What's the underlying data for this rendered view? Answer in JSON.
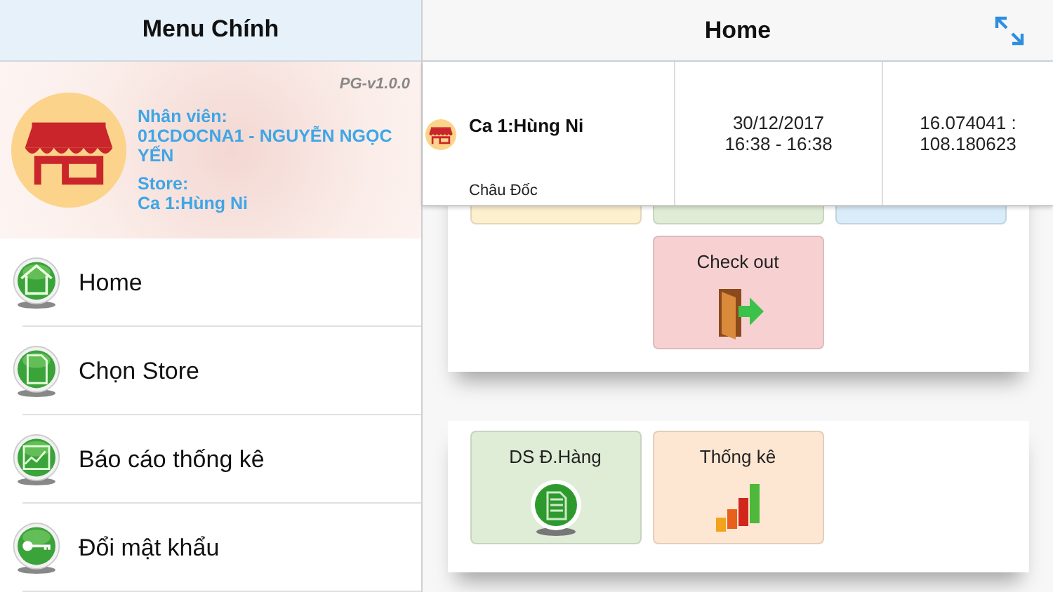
{
  "sidebar": {
    "title": "Menu Chính",
    "version": "PG-v1.0.0",
    "employee_label": "Nhân viên:",
    "employee": "01CDOCNA1 - NGUYỄN NGỌC YẾN",
    "store_label": "Store:",
    "store": "Ca 1:Hùng Ni",
    "items": [
      {
        "label": "Home",
        "kind": "home"
      },
      {
        "label": "Chọn Store",
        "kind": "document"
      },
      {
        "label": "Báo cáo thống kê",
        "kind": "chart"
      },
      {
        "label": "Đổi mật khẩu",
        "kind": "key"
      }
    ]
  },
  "main": {
    "title": "Home",
    "cards": [
      {
        "tiles": [
          {
            "kind": "hidden",
            "color": "#fdf0cf"
          },
          {
            "kind": "hidden",
            "color": "#dfecd6"
          },
          {
            "kind": "hidden",
            "color": "#d9ecfa"
          },
          {
            "kind": "checkout",
            "label": "Check out",
            "color": "#f7d1d1"
          }
        ]
      },
      {
        "tiles": [
          {
            "kind": "orders",
            "label": "DS Đ.Hàng",
            "color": "#dfecd6"
          },
          {
            "kind": "stats",
            "label": "Thống kê",
            "color": "#fde6d2"
          }
        ]
      }
    ],
    "checkin": {
      "store": "Ca 1:Hùng Ni",
      "district": "Châu Đốc",
      "date": "30/12/2017",
      "time": "16:38 - 16:38",
      "coordinates": "16.074041 : 108.180623"
    }
  }
}
